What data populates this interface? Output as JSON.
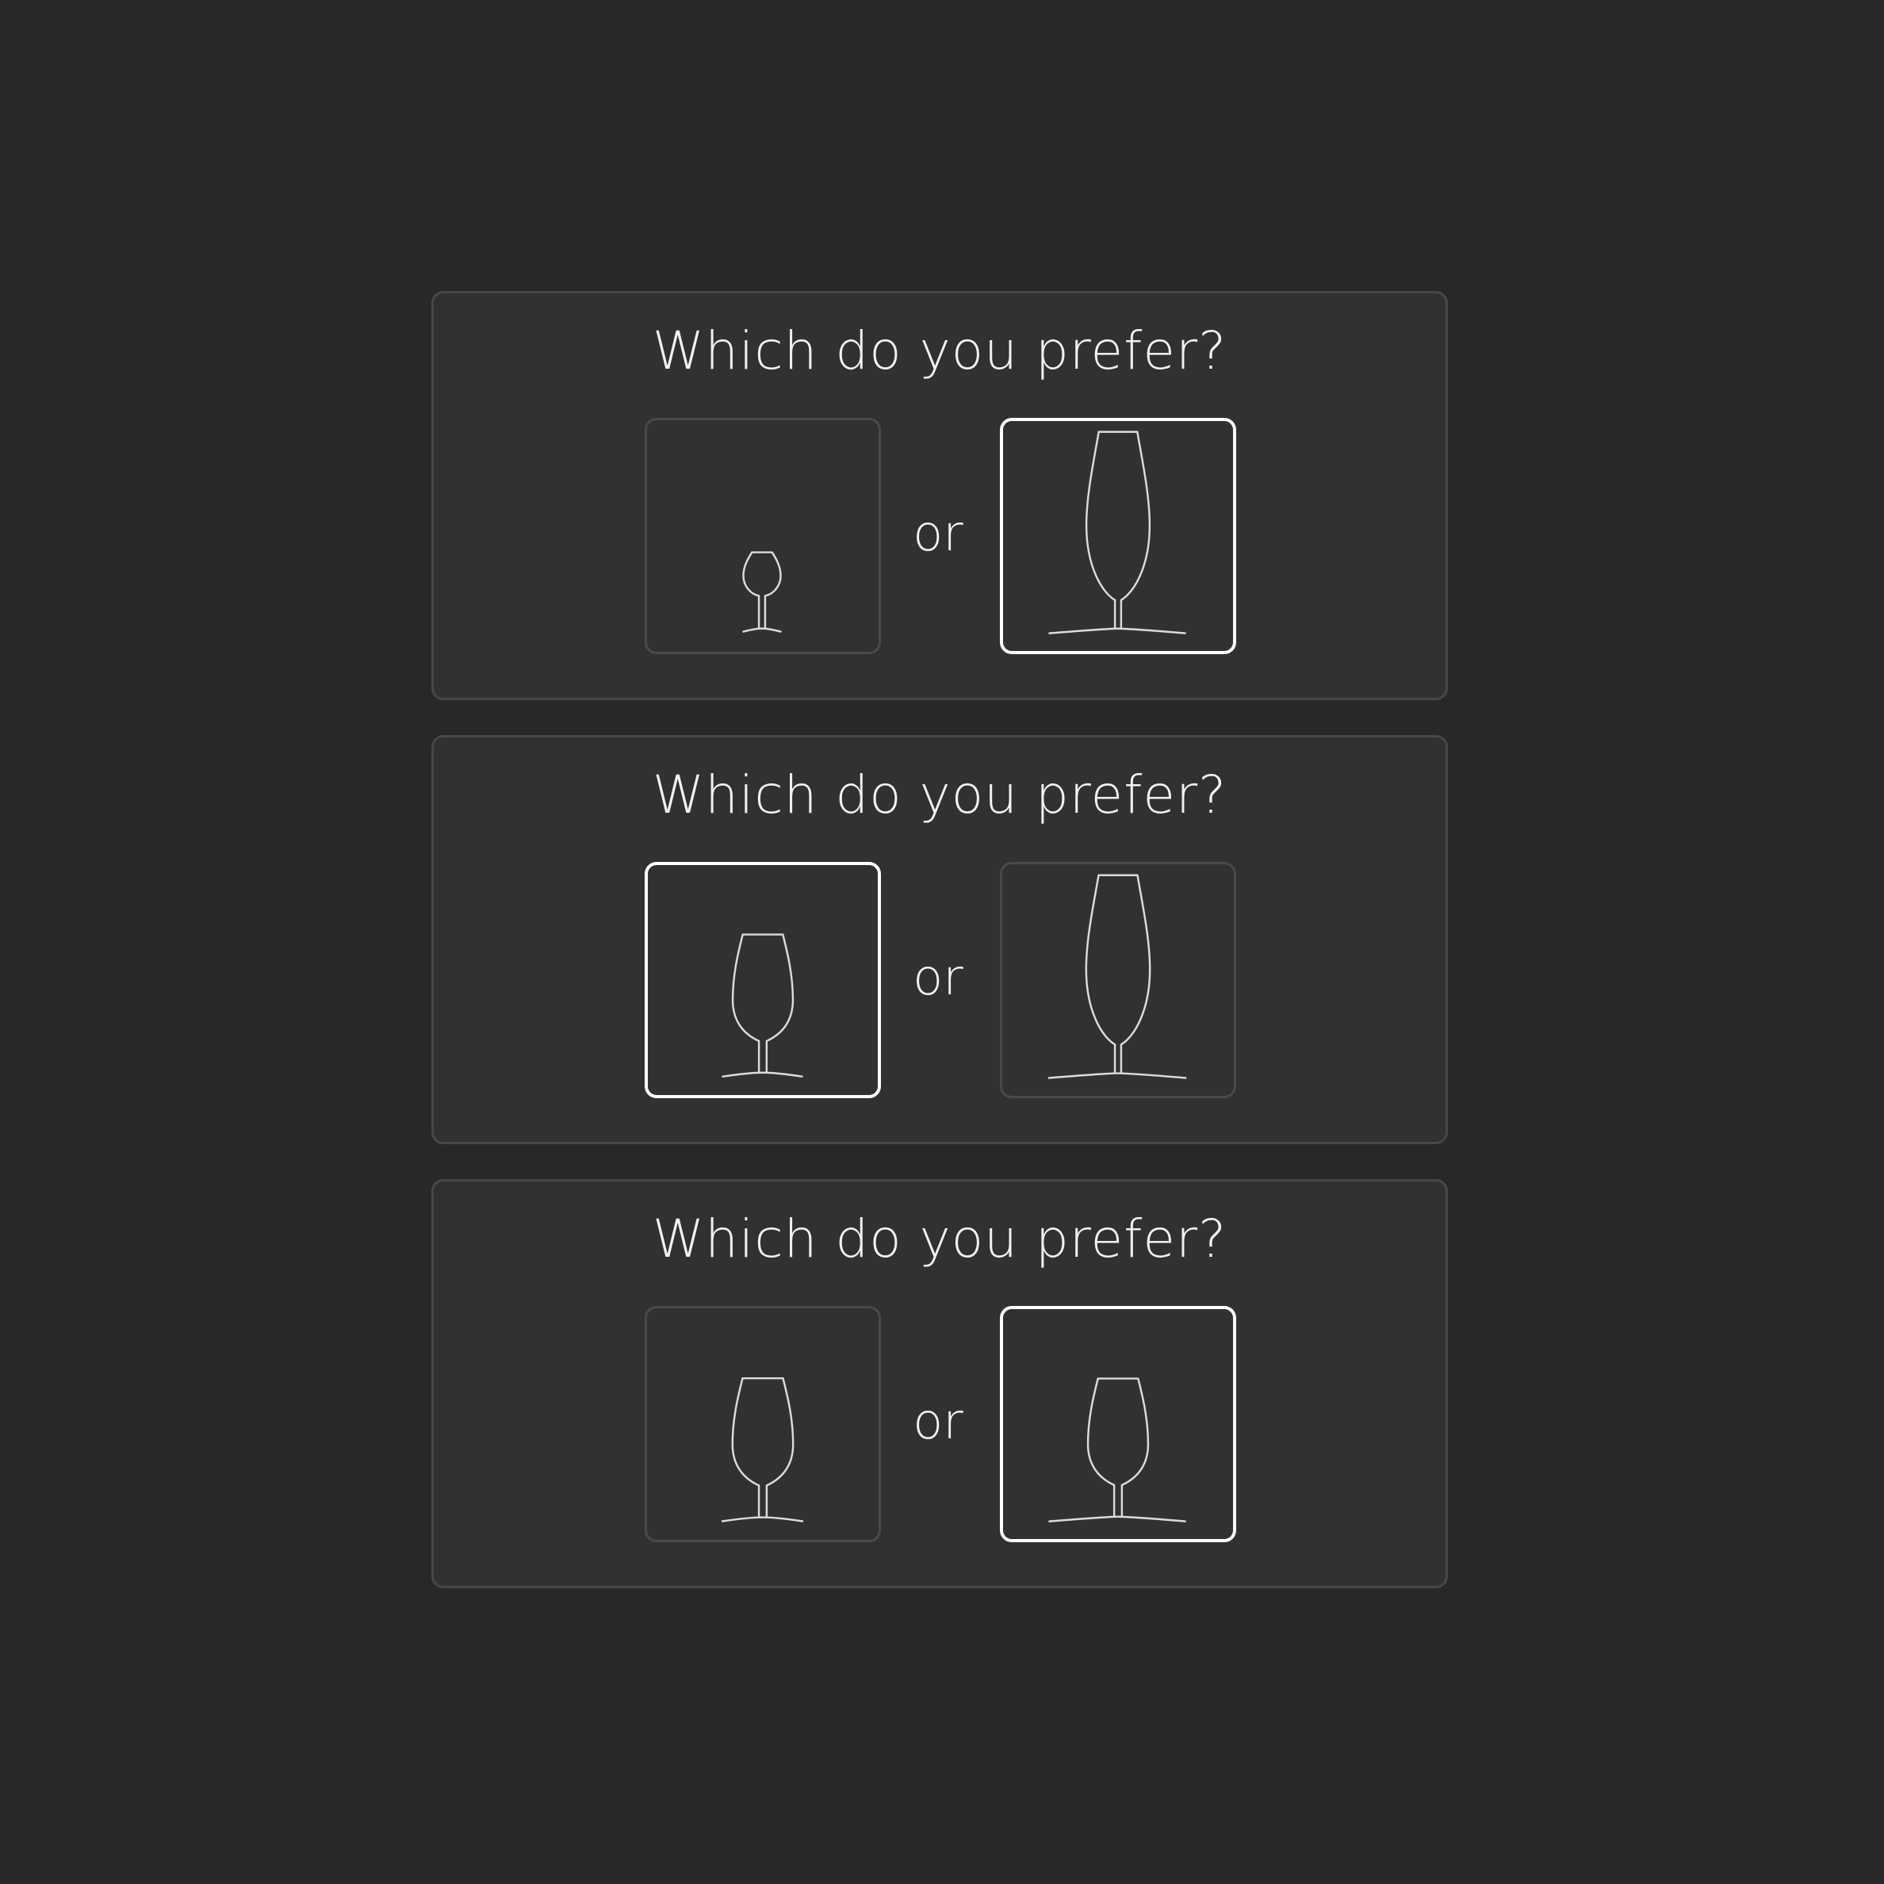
{
  "questions": [
    {
      "title": "Which do you prefer?",
      "separator": "or",
      "options": [
        {
          "glass": "snifter-glass-icon",
          "selected": false
        },
        {
          "glass": "flute-glass-icon",
          "selected": true
        }
      ]
    },
    {
      "title": "Which do you prefer?",
      "separator": "or",
      "options": [
        {
          "glass": "tulip-glass-icon",
          "selected": true
        },
        {
          "glass": "flute-glass-icon",
          "selected": false
        }
      ]
    },
    {
      "title": "Which do you prefer?",
      "separator": "or",
      "options": [
        {
          "glass": "tulip-glass-icon",
          "selected": false
        },
        {
          "glass": "tulip-glass-icon",
          "selected": true
        }
      ]
    }
  ],
  "colors": {
    "background": "#282828",
    "card": "#313131",
    "card_border": "#474747",
    "option_border": "#4a4a4a",
    "selected_border": "#ffffff",
    "text": "#f2f2f2",
    "glass_stroke": "#dcdcdc"
  }
}
